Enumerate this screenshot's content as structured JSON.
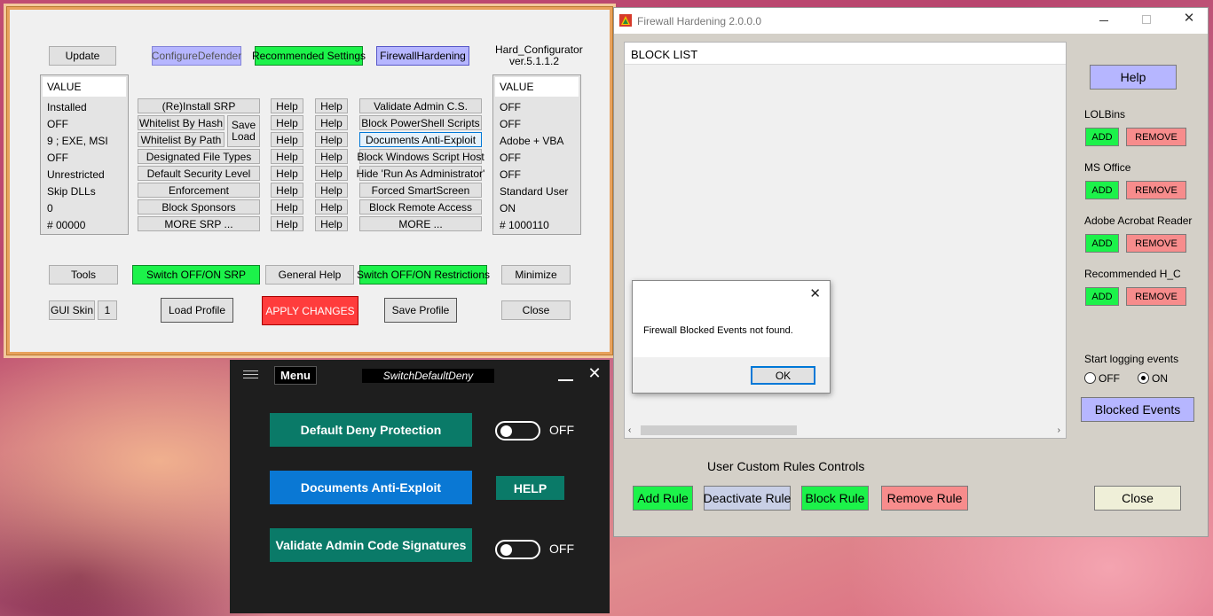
{
  "hc": {
    "update": "Update",
    "configure_defender": "ConfigureDefender",
    "recommended_settings": "Recommended Settings",
    "firewall_hardening": "FirewallHardening",
    "app_name": "Hard_Configurator",
    "version": "ver.5.1.1.2",
    "left_header": "VALUE",
    "left_values": [
      "Installed",
      "OFF",
      "9 ;  EXE, MSI",
      "OFF",
      "Unrestricted",
      "Skip DLLs",
      "0",
      "# 00000"
    ],
    "srp_buttons": [
      "(Re)Install SRP",
      "Whitelist By Hash",
      "Whitelist By Path",
      "Designated File Types",
      "Default Security Level",
      "Enforcement",
      "Block Sponsors",
      "MORE SRP ..."
    ],
    "save_load": [
      "Save",
      "Load"
    ],
    "help": "Help",
    "right_buttons": [
      "Validate Admin C.S.",
      "Block PowerShell Scripts",
      "Documents Anti-Exploit",
      "Block Windows Script Host",
      "Hide  'Run As Administrator'",
      "Forced SmartScreen",
      "Block Remote Access",
      "MORE ..."
    ],
    "right_header": "VALUE",
    "right_values": [
      "OFF",
      "OFF",
      "Adobe + VBA",
      "OFF",
      "OFF",
      "Standard User",
      "ON",
      "# 1000110"
    ],
    "tools": "Tools",
    "switch_srp": "Switch OFF/ON SRP",
    "general_help": "General Help",
    "switch_restrictions": "Switch OFF/ON Restrictions",
    "minimize": "Minimize",
    "gui_skin": "GUI Skin",
    "gui_skin_value": "1",
    "load_profile": "Load Profile",
    "apply_changes": "APPLY CHANGES",
    "save_profile": "Save Profile",
    "close": "Close"
  },
  "sdd": {
    "menu": "Menu",
    "title": "SwitchDefaultDeny",
    "default_deny": "Default Deny Protection",
    "default_deny_state": "OFF",
    "documents_anti_exploit": "Documents Anti-Exploit",
    "help": "HELP",
    "validate_admin": "Validate Admin Code Signatures",
    "validate_admin_state": "OFF"
  },
  "fw": {
    "title": "Firewall Hardening 2.0.0.0",
    "block_list_header": "BLOCK LIST",
    "help": "Help",
    "groups": [
      {
        "label": "LOLBins",
        "add": "ADD",
        "remove": "REMOVE"
      },
      {
        "label": "MS Office",
        "add": "ADD",
        "remove": "REMOVE"
      },
      {
        "label": "Adobe Acrobat Reader",
        "add": "ADD",
        "remove": "REMOVE"
      },
      {
        "label": "Recommended H_C",
        "add": "ADD",
        "remove": "REMOVE"
      }
    ],
    "start_logging": "Start logging events",
    "radio_off": "OFF",
    "radio_on": "ON",
    "radio_selected": "ON",
    "blocked_events": "Blocked Events",
    "user_rules_title": "User Custom Rules Controls",
    "add_rule": "Add Rule",
    "deactivate_rule": "Deactivate Rule",
    "block_rule": "Block Rule",
    "remove_rule": "Remove Rule",
    "close": "Close"
  },
  "dialog": {
    "message": "Firewall Blocked Events not found.",
    "ok": "OK"
  },
  "colors": {
    "green": "#1cf24a",
    "pink": "#f78c8c",
    "lavender": "#b6b6ff",
    "red_apply": "#ff3c3c",
    "teal": "#0a7a68",
    "blue": "#0a78d4"
  }
}
